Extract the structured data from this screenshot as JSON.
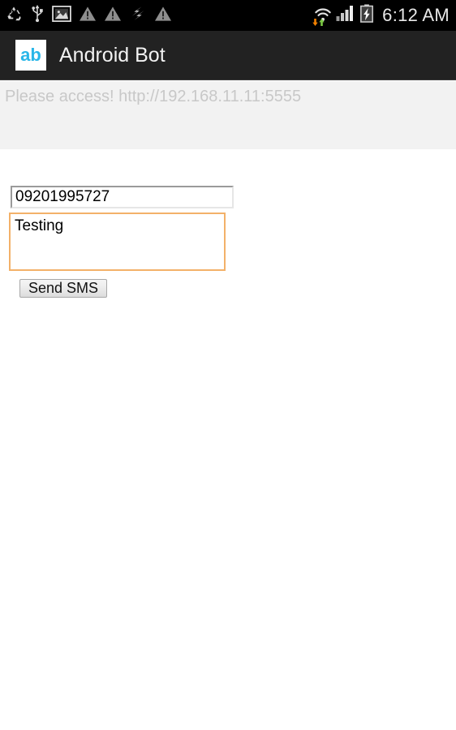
{
  "status_bar": {
    "background": "#000000",
    "clock": "6:12 AM",
    "left_icons": [
      {
        "name": "recycle-icon",
        "label": "recycle"
      },
      {
        "name": "usb-icon",
        "label": "usb"
      },
      {
        "name": "image-icon",
        "label": "image"
      },
      {
        "name": "warning-icon",
        "label": "warning"
      },
      {
        "name": "warning-icon",
        "label": "warning"
      },
      {
        "name": "data-transfer-icon",
        "label": "data transfer"
      },
      {
        "name": "warning-icon",
        "label": "warning"
      }
    ],
    "right_icons": [
      {
        "name": "wifi-icon",
        "label": "wifi"
      },
      {
        "name": "signal-icon",
        "label": "signal"
      },
      {
        "name": "battery-charging-icon",
        "label": "battery charging"
      }
    ],
    "data_arrow_color": "#f08000"
  },
  "title_bar": {
    "background": "#222222",
    "app_icon_text": "ab",
    "app_icon_color": "#29b6e8",
    "title": "Android Bot"
  },
  "page": {
    "notice": "Please access! http://192.168.11.11:5555",
    "notice_color": "#c8c8c8",
    "notice_background": "#f2f2f2"
  },
  "form": {
    "phone": {
      "value": "09201995727",
      "placeholder": ""
    },
    "message": {
      "value": "Testing",
      "placeholder": "",
      "focus_border_color": "#f3b169"
    },
    "send_label": "Send SMS"
  }
}
